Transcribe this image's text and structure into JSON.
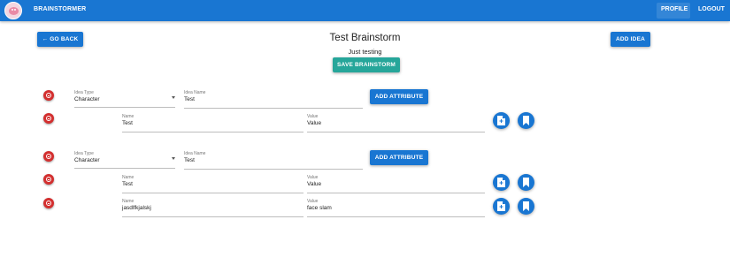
{
  "header": {
    "brand": "BRAINSTORMER",
    "profile": "PROFILE",
    "logout": "LOGOUT"
  },
  "toolbar": {
    "go_back": "← GO BACK",
    "add_idea": "ADD IDEA",
    "save": "SAVE BRAINSTORM"
  },
  "brainstorm": {
    "title": "Test Brainstorm",
    "description": "Just testing"
  },
  "ideas": [
    {
      "type_label": "Idea Type",
      "type_value": "Character",
      "name_label": "Idea Name",
      "name_value": "Test",
      "add_attribute": "ADD ATTRIBUTE",
      "attributes": [
        {
          "name_label": "Name",
          "name_value": "Test",
          "value_label": "Value",
          "value_value": "Value"
        }
      ]
    },
    {
      "type_label": "Idea Type",
      "type_value": "Character",
      "name_label": "Idea Name",
      "name_value": "Test",
      "add_attribute": "ADD ATTRIBUTE",
      "attributes": [
        {
          "name_label": "Name",
          "name_value": "Test",
          "value_label": "Value",
          "value_value": "Value"
        },
        {
          "name_label": "Name",
          "name_value": "jasdlfkjalskj",
          "value_label": "Value",
          "value_value": "face slam"
        }
      ]
    }
  ],
  "colors": {
    "primary": "#1976d2",
    "save": "#26a69a",
    "delete": "#d32f2f"
  },
  "icons": {
    "delete": "remove-circle-icon",
    "file": "file-icon",
    "bookmark": "bookmark-icon"
  }
}
